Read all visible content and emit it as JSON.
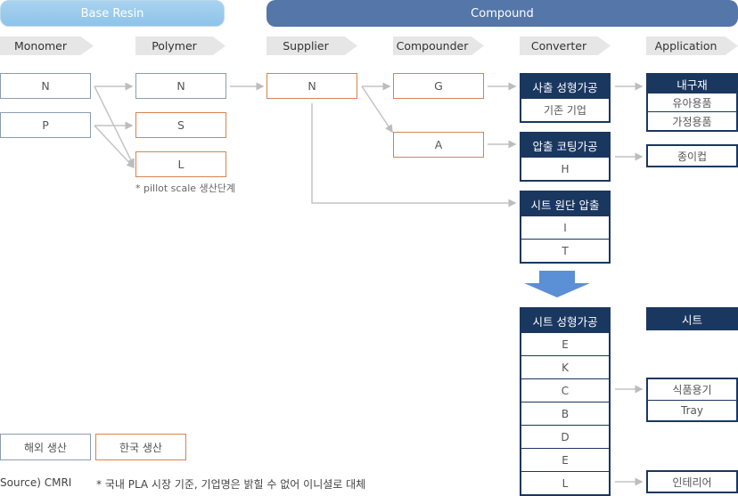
{
  "bands": {
    "base_resin": "Base Resin",
    "compound": "Compound"
  },
  "stages": [
    "Monomer",
    "Polymer",
    "Supplier",
    "Compounder",
    "Converter",
    "Application"
  ],
  "monomer": [
    "N",
    "P"
  ],
  "polymer": [
    "N",
    "S",
    "L"
  ],
  "polymer_note": "* pillot scale 생산단계",
  "supplier": [
    "N"
  ],
  "compounder": [
    "G",
    "A"
  ],
  "converter": {
    "injection": {
      "title": "사출 성형가공",
      "items": [
        "기존 기업"
      ]
    },
    "coating": {
      "title": "압출 코팅가공",
      "items": [
        "H"
      ]
    },
    "sheet_extrusion": {
      "title": "시트 원단 압출",
      "items": [
        "I",
        "T"
      ]
    },
    "sheet_forming": {
      "title": "시트 성형가공",
      "items": [
        "E",
        "K",
        "C",
        "B",
        "D",
        "E",
        "L"
      ]
    }
  },
  "application": {
    "durables": {
      "title": "내구재",
      "items": [
        "유아용품",
        "가정용품"
      ]
    },
    "paper_cup": "종이컵",
    "sheet_header": "시트",
    "food_container": {
      "title": "식품용기",
      "items": [
        "Tray"
      ]
    },
    "interior": "인테리어"
  },
  "legend": {
    "overseas": "해외 생산",
    "korea": "한국 생산"
  },
  "colors": {
    "overseas_border": "#8b9db0",
    "korea_border": "#d8834e",
    "navy": "#1a3760",
    "compound_band": "#5476a8",
    "base_band": "#96c8ec",
    "arrow": "#5b8fd6"
  },
  "footer": {
    "source": "Source) CMRI",
    "note": "* 국내 PLA 시장 기준, 기업명은 밝힐 수 없어 이니셜로 대체"
  }
}
